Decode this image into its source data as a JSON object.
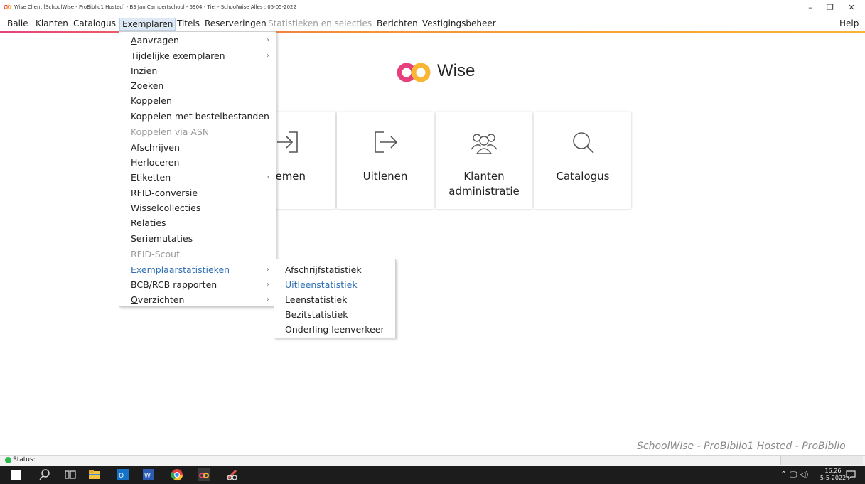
{
  "window": {
    "title": "Wise Client [SchoolWise - ProBiblio1 Hosted] - BS Jan Campertschool - 5904 - Tiel - SchoolWise Alles : 05-05-2022",
    "minimize": "–",
    "maximize": "❐",
    "close": "✕"
  },
  "menu": {
    "balie": "Balie",
    "klanten": "Klanten",
    "catalogus": "Catalogus",
    "exemplaren": "Exemplaren",
    "titels": "Titels",
    "reserveringen": "Reserveringen",
    "statistieken": "Statistieken en selecties",
    "berichten": "Berichten",
    "vestigingsbeheer": "Vestigingsbeheer",
    "help": "Help"
  },
  "logo": {
    "text": "Wise",
    "colors": [
      "#e6407f",
      "#f39235",
      "#f8b634"
    ]
  },
  "tiles": {
    "innemen": "nemen",
    "uitlenen": "Uitlenen",
    "klanten_line1": "Klanten",
    "klanten_line2": "administratie",
    "catalogus": "Catalogus"
  },
  "dropdown": {
    "aanvragen_first": "A",
    "aanvragen_rest": "anvragen",
    "tijdelijk_first": "T",
    "tijdelijk_rest": "ijdelijke exemplaren",
    "inzien": "Inzien",
    "zoeken": "Zoeken",
    "koppelen": "Koppelen",
    "koppelen_bestel": "Koppelen met bestelbestanden",
    "koppelen_asn": "Koppelen via ASN",
    "afschrijven": "Afschrijven",
    "herloceren": "Herloceren",
    "etiketten": "Etiketten",
    "rfid_conversie": "RFID-conversie",
    "wisselcollecties": "Wisselcollecties",
    "relaties": "Relaties",
    "seriemutaties": "Seriemutaties",
    "rfid_scout": "RFID-Scout",
    "exemplaarstatistieken": "Exemplaarstatistieken",
    "bcb_first": "B",
    "bcb_rest": "CB/RCB rapporten",
    "overzichten_first": "O",
    "overzichten_rest": "verzichten",
    "arrow": "›"
  },
  "submenu": {
    "afschrijf": "Afschrijfstatistiek",
    "uitleen": "Uitleenstatistiek",
    "leen": "Leenstatistiek",
    "bezit": "Bezitstatistiek",
    "onderling": "Onderling leenverkeer"
  },
  "footer": {
    "brand": "SchoolWise - ProBiblio1 Hosted - ProBiblio",
    "status": "Status:"
  },
  "taskbar": {
    "time": "16:26",
    "date": "5-5-2022",
    "tray": "^ 🖵 ◁)"
  },
  "colors": {
    "accent_blue": "#2e6fb4",
    "status_green": "#2db84b"
  }
}
